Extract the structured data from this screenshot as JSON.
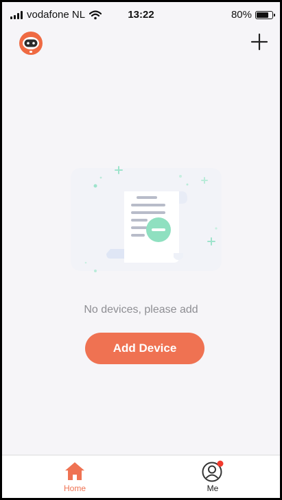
{
  "statusbar": {
    "carrier": "vodafone NL",
    "time": "13:22",
    "battery": "80%",
    "battery_level": 0.8
  },
  "header": {
    "avatar_icon": "robot-avatar-icon",
    "add_icon": "plus-icon"
  },
  "empty_state": {
    "message": "No devices, please add",
    "illustration_icon": "empty-document-icon"
  },
  "actions": {
    "add_device_label": "Add Device"
  },
  "tabbar": {
    "tabs": [
      {
        "label": "Home",
        "icon": "home-icon",
        "active": true
      },
      {
        "label": "Me",
        "icon": "profile-icon",
        "active": false,
        "badge": true
      }
    ]
  },
  "colors": {
    "accent": "#ef7252",
    "background": "#f6f5f8",
    "illustration_green": "#8fe0c0",
    "badge_red": "#f23a2e"
  }
}
